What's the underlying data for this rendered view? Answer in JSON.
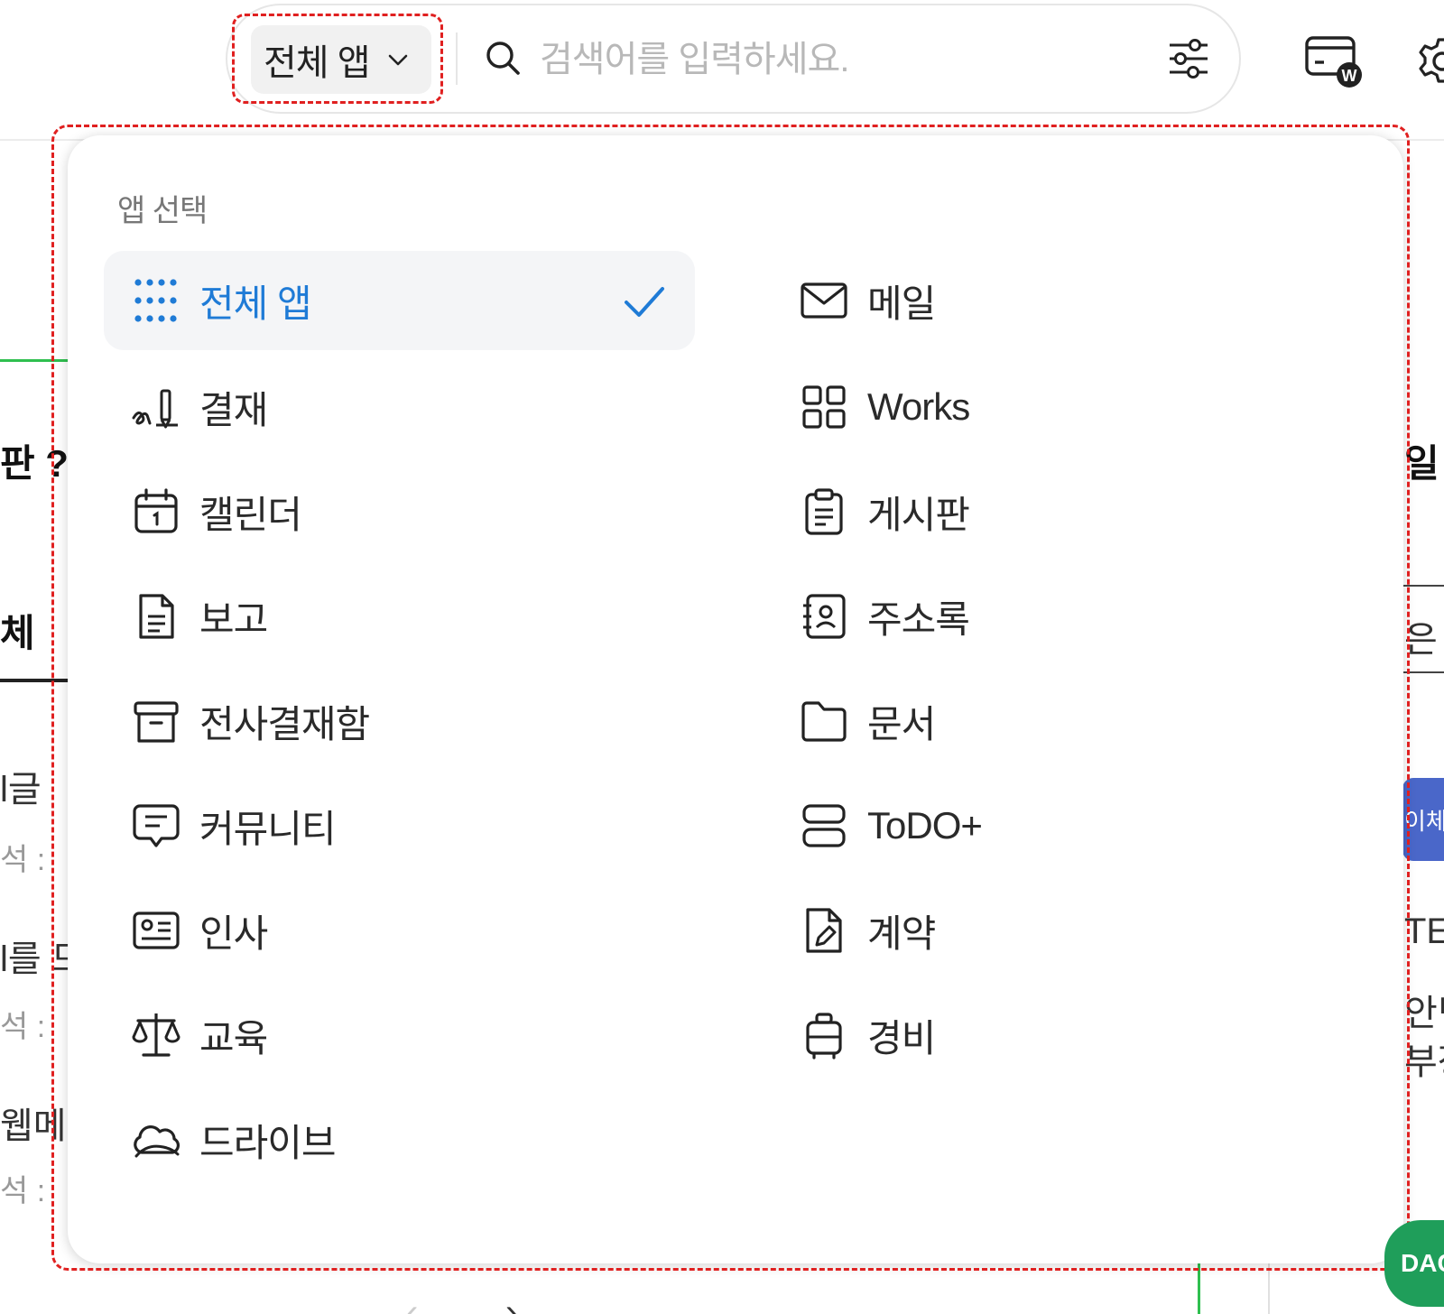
{
  "search": {
    "scope_label": "전체 앱",
    "placeholder": "검색어를 입력하세요."
  },
  "dropdown": {
    "heading": "앱 선택",
    "items_left": [
      {
        "label": "전체 앱",
        "icon": "grid-dots-icon",
        "selected": true
      },
      {
        "label": "결재",
        "icon": "signature-icon"
      },
      {
        "label": "캘린더",
        "icon": "calendar-icon"
      },
      {
        "label": "보고",
        "icon": "report-document-icon"
      },
      {
        "label": "전사결재함",
        "icon": "archive-box-icon"
      },
      {
        "label": "커뮤니티",
        "icon": "chat-bubble-icon"
      },
      {
        "label": "인사",
        "icon": "id-card-icon"
      },
      {
        "label": "교육",
        "icon": "scale-icon"
      },
      {
        "label": "드라이브",
        "icon": "cloud-icon"
      }
    ],
    "items_right": [
      {
        "label": "메일",
        "icon": "mail-icon"
      },
      {
        "label": "Works",
        "icon": "four-squares-icon"
      },
      {
        "label": "게시판",
        "icon": "clipboard-icon"
      },
      {
        "label": "주소록",
        "icon": "address-book-icon"
      },
      {
        "label": "문서",
        "icon": "folder-icon"
      },
      {
        "label": "ToDO+",
        "icon": "stacked-boxes-icon"
      },
      {
        "label": "계약",
        "icon": "contract-pen-icon"
      },
      {
        "label": "경비",
        "icon": "luggage-icon"
      }
    ]
  },
  "background": {
    "left_fragments": [
      "판 ?",
      "체",
      "l글",
      "석 :",
      "l를 므",
      "석 :",
      "웹메",
      "석 :"
    ],
    "right_fragments": [
      "일 ㄹ",
      "은ㄷ",
      "이체",
      "TES",
      "안녕",
      "부장",
      "DAC"
    ]
  },
  "colors": {
    "accent_blue": "#1f7bd6",
    "highlight_red": "#e02020",
    "badge_blue": "#4a67c9",
    "badge_green": "#1f9e5a"
  }
}
